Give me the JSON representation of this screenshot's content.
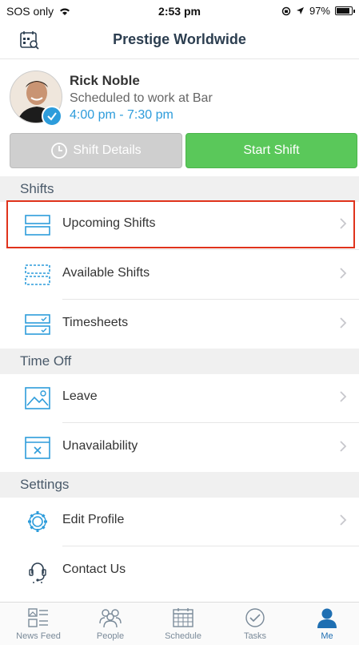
{
  "status": {
    "carrier": "SOS only",
    "time": "2:53 pm",
    "battery": "97%"
  },
  "header": {
    "title": "Prestige Worldwide"
  },
  "profile": {
    "name": "Rick Noble",
    "subtitle": "Scheduled to work at Bar",
    "shift_time": "4:00 pm - 7:30 pm"
  },
  "buttons": {
    "details": "Shift Details",
    "start": "Start Shift"
  },
  "sections": {
    "shifts": {
      "title": "Shifts",
      "items": [
        "Upcoming Shifts",
        "Available Shifts",
        "Timesheets"
      ]
    },
    "time_off": {
      "title": "Time Off",
      "items": [
        "Leave",
        "Unavailability"
      ]
    },
    "settings": {
      "title": "Settings",
      "items": [
        "Edit Profile",
        "Contact Us"
      ]
    }
  },
  "tabs": [
    "News Feed",
    "People",
    "Schedule",
    "Tasks",
    "Me"
  ],
  "colors": {
    "accent": "#2d9cdb",
    "start": "#5ac85a",
    "highlight": "#e0331c",
    "header": "#2c3e50"
  }
}
